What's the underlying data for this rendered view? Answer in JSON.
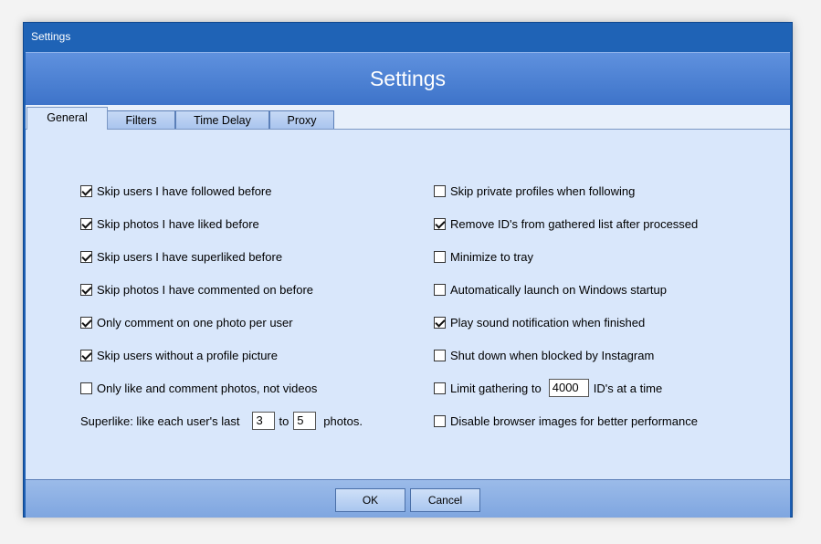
{
  "window": {
    "title": "Settings"
  },
  "banner": {
    "title": "Settings"
  },
  "tabs": [
    {
      "label": "General",
      "active": true
    },
    {
      "label": "Filters",
      "active": false
    },
    {
      "label": "Time Delay",
      "active": false
    },
    {
      "label": "Proxy",
      "active": false
    }
  ],
  "left": [
    {
      "label": "Skip users I have followed before",
      "checked": true
    },
    {
      "label": "Skip photos I have liked before",
      "checked": true
    },
    {
      "label": "Skip users I have superliked before",
      "checked": true
    },
    {
      "label": "Skip photos I have commented on before",
      "checked": true
    },
    {
      "label": "Only comment on one photo per user",
      "checked": true
    },
    {
      "label": "Skip users without a profile picture",
      "checked": true
    },
    {
      "label": "Only like and comment photos, not videos",
      "checked": false
    }
  ],
  "superlike": {
    "prefix": "Superlike:  like each user's last",
    "from": "3",
    "to_label": "to",
    "to": "5",
    "suffix": "photos."
  },
  "right": [
    {
      "label": "Skip private profiles when following",
      "checked": false
    },
    {
      "label": "Remove ID's from gathered list after processed",
      "checked": true
    },
    {
      "label": "Minimize to tray",
      "checked": false
    },
    {
      "label": "Automatically launch on Windows startup",
      "checked": false
    },
    {
      "label": "Play sound notification when finished",
      "checked": true
    },
    {
      "label": "Shut down when blocked by Instagram",
      "checked": false
    }
  ],
  "limit": {
    "prefix": "Limit gathering to",
    "value": "4000",
    "suffix": "ID's at a time",
    "checked": false
  },
  "disable_images": {
    "label": "Disable browser images for better performance",
    "checked": false
  },
  "buttons": {
    "ok": "OK",
    "cancel": "Cancel"
  }
}
